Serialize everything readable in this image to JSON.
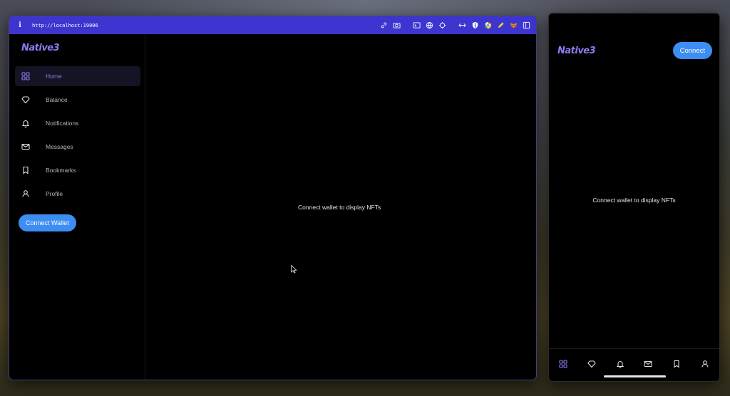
{
  "browser": {
    "url": "http://localhost:19006",
    "toolbar_icons": [
      "link-icon",
      "camera-icon",
      "terminal-icon",
      "globe-icon",
      "crosshair-icon",
      "expand-icon",
      "shield-icon",
      "chrome-icon",
      "pencil-icon",
      "fox-icon",
      "sidebar-icon"
    ]
  },
  "app": {
    "logo": "Native3",
    "nav": [
      {
        "label": "Home",
        "icon": "grid-icon",
        "active": true
      },
      {
        "label": "Balance",
        "icon": "diamond-icon",
        "active": false
      },
      {
        "label": "Notifications",
        "icon": "bell-icon",
        "active": false
      },
      {
        "label": "Messages",
        "icon": "mail-icon",
        "active": false
      },
      {
        "label": "Bookmarks",
        "icon": "bookmark-icon",
        "active": false
      },
      {
        "label": "Profile",
        "icon": "user-icon",
        "active": false
      }
    ],
    "connect_wallet_label": "Connect Wallet",
    "main_message": "Connect wallet to display NFTs"
  },
  "mobile": {
    "logo": "Native3",
    "connect_label": "Connect",
    "message": "Connect wallet to display NFTs",
    "tabs": [
      "grid-icon",
      "diamond-icon",
      "bell-icon",
      "mail-icon",
      "bookmark-icon",
      "user-icon"
    ]
  },
  "colors": {
    "accent": "#8d7cf2",
    "button": "#3d8ef2",
    "urlbar": "#3c35cf",
    "background": "#000000"
  }
}
